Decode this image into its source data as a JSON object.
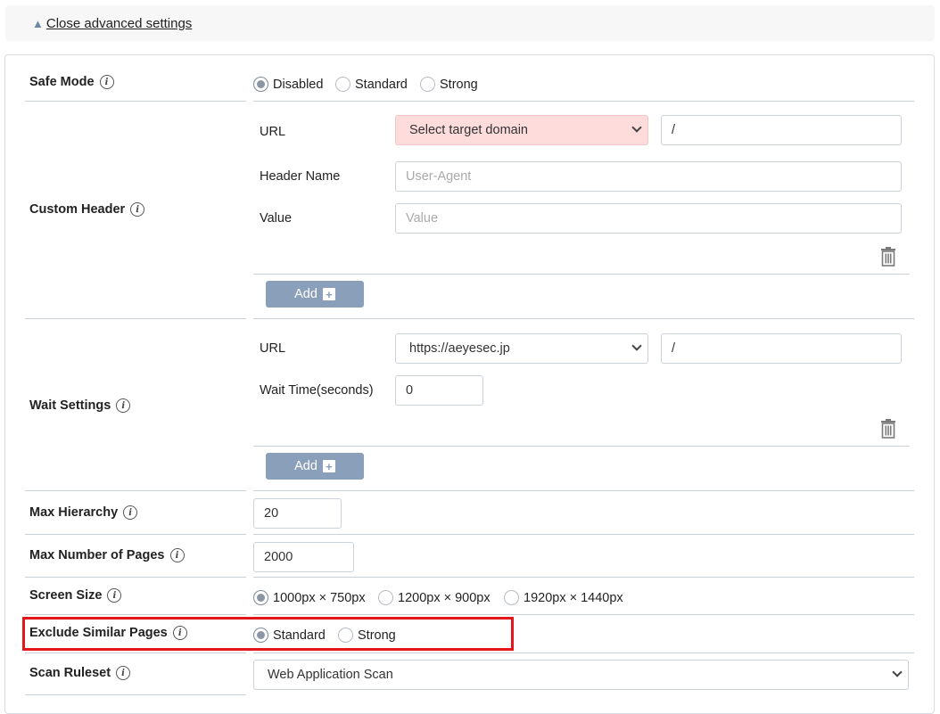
{
  "top": {
    "toggle_label": "Close advanced settings"
  },
  "safe_mode": {
    "label": "Safe Mode",
    "options": [
      "Disabled",
      "Standard",
      "Strong"
    ],
    "selected": "Disabled"
  },
  "custom_header": {
    "label": "Custom Header",
    "url_label": "URL",
    "domain_select": "Select target domain",
    "path_value": "/",
    "header_name_label": "Header Name",
    "header_name_placeholder": "User-Agent",
    "value_label": "Value",
    "value_placeholder": "Value",
    "add_label": "Add",
    "trash_icon": "trash-icon"
  },
  "wait_settings": {
    "label": "Wait Settings",
    "url_label": "URL",
    "domain_select": "https://aeyesec.jp",
    "path_value": "/",
    "wait_time_label": "Wait Time(seconds)",
    "wait_time_value": "0",
    "add_label": "Add"
  },
  "max_hierarchy": {
    "label": "Max Hierarchy",
    "value": "20"
  },
  "max_pages": {
    "label": "Max Number of Pages",
    "value": "2000"
  },
  "screen_size": {
    "label": "Screen Size",
    "options": [
      "1000px × 750px",
      "1200px × 900px",
      "1920px × 1440px"
    ],
    "selected": "1000px × 750px"
  },
  "exclude_similar": {
    "label": "Exclude Similar Pages",
    "options": [
      "Standard",
      "Strong"
    ],
    "selected": "Standard"
  },
  "scan_ruleset": {
    "label": "Scan Ruleset",
    "selected": "Web Application Scan"
  },
  "colors": {
    "highlight": "#e2161b",
    "button": "#8aa0ba",
    "warn_select": "#ffdcdc"
  }
}
